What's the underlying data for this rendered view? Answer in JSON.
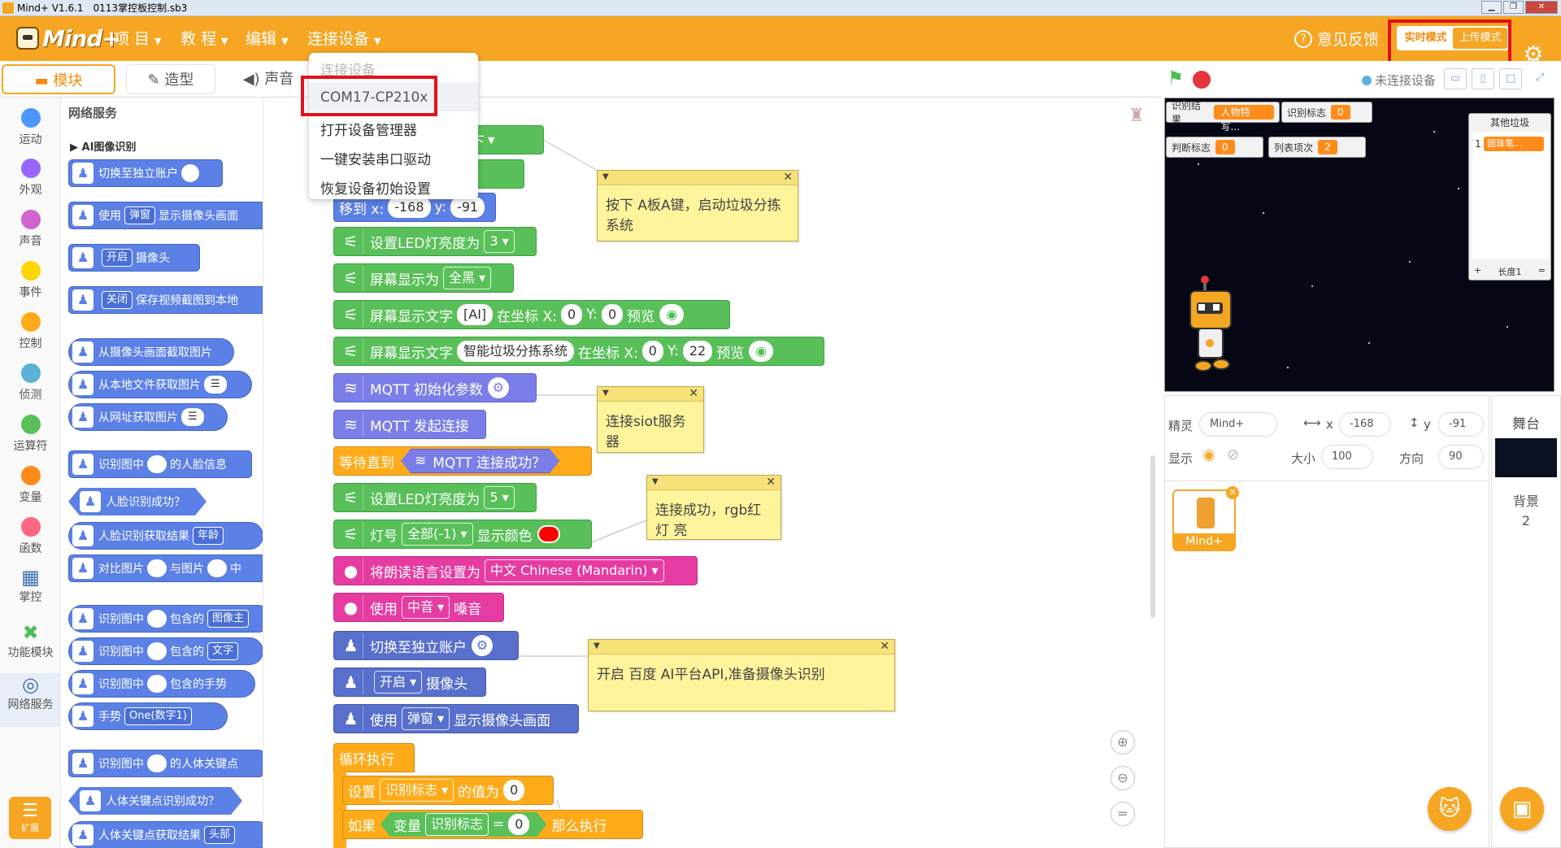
{
  "window": {
    "app_title": "Mind+ V1.6.1",
    "file_name": "0113掌控板控制.sb3"
  },
  "menubar": {
    "logo_text": "Mind+",
    "items": [
      {
        "label": "项 目"
      },
      {
        "label": "教 程"
      },
      {
        "label": "编辑"
      },
      {
        "label": "连接设备"
      }
    ],
    "feedback": "意见反馈",
    "mode_realtime": "实时模式",
    "mode_upload": "上传模式"
  },
  "tabs": {
    "code": "模块",
    "costume": "造型",
    "sound": "声音"
  },
  "device_menu": {
    "header": "连接设备",
    "port": "COM17-CP210x",
    "open_manager": "打开设备管理器",
    "install_driver": "一键安装串口驱动",
    "reset_device": "恢复设备初始设置"
  },
  "categories": [
    {
      "label": "运动",
      "color": "#4c97ff"
    },
    {
      "label": "外观",
      "color": "#9966ff"
    },
    {
      "label": "声音",
      "color": "#cf63cf"
    },
    {
      "label": "事件",
      "color": "#ffd500"
    },
    {
      "label": "控制",
      "color": "#ffab19"
    },
    {
      "label": "侦测",
      "color": "#5cb1d6"
    },
    {
      "label": "运算符",
      "color": "#59c059"
    },
    {
      "label": "变量",
      "color": "#ff8c1a"
    },
    {
      "label": "函数",
      "color": "#ff6680"
    },
    {
      "label": "掌控",
      "icon": "chip-icon"
    },
    {
      "label": "功能模块",
      "icon": "tools-icon"
    },
    {
      "label": "网络服务",
      "icon": "globe-icon"
    }
  ],
  "extension_label": "扩展",
  "palette": {
    "title": "网络服务",
    "subtitle": "AI图像识别",
    "blocks": {
      "b1": "切换至独立账户",
      "b2a": "使用",
      "b2b": "弹窗",
      "b2c": "显示摄像头画面",
      "b3a": "开启",
      "b3b": "摄像头",
      "b4a": "关闭",
      "b4b": "保存视频截图到本地",
      "b5": "从摄像头画面截取图片",
      "b6": "从本地文件获取图片",
      "b7": "从网址获取图片",
      "b8a": "识别图中",
      "b8b": "的人脸信息",
      "b9": "人脸识别成功？",
      "b10a": "人脸识别获取结果",
      "b10b": "年龄",
      "b11a": "对比图片",
      "b11b": "与图片",
      "b11c": "中",
      "b12a": "识别图中",
      "b12b": "包含的",
      "b12c": "图像主",
      "b13a": "识别图中",
      "b13b": "包含的",
      "b13c": "文字",
      "b14a": "识别图中",
      "b14b": "包含的手势",
      "b15a": "手势",
      "b15b": "One(数字1)",
      "b16a": "识别图中",
      "b16b": "的人体关键点",
      "b17": "人体关键点识别成功？",
      "b18a": "人体关键点获取结果",
      "b18b": "头部"
    }
  },
  "script": {
    "b_press": "按下",
    "b_led": "ED",
    "b_move": {
      "label": "移到 x:",
      "x": "-168",
      "ylabel": "y:",
      "y": "-91"
    },
    "b_led_brightness": {
      "label": "设置LED灯亮度为",
      "value": "3"
    },
    "b_screen_show": {
      "label": "屏幕显示为",
      "value": "全黑"
    },
    "b_screen_text1": {
      "label": "屏幕显示文字",
      "text": "[AI]",
      "coord": "在坐标 X:",
      "x": "0",
      "y_label": "Y:",
      "y": "0",
      "preview": "预览"
    },
    "b_screen_text2": {
      "label": "屏幕显示文字",
      "text": "智能垃圾分拣系统",
      "coord": "在坐标 X:",
      "x": "0",
      "y_label": "Y:",
      "y": "22",
      "preview": "预览"
    },
    "b_mqtt_init": "MQTT 初始化参数",
    "b_mqtt_connect": "MQTT 发起连接",
    "b_wait": {
      "label": "等待直到",
      "cond": "MQTT 连接成功？"
    },
    "b_led_brightness2": {
      "label": "设置LED灯亮度为",
      "value": "5"
    },
    "b_lamp": {
      "label": "灯号",
      "value": "全部(-1)",
      "color_label": "显示颜色"
    },
    "b_tts_lang": {
      "label": "将朗读语言设置为",
      "value": "中文 Chinese (Mandarin)"
    },
    "b_tts_voice": {
      "label": "使用",
      "value": "中音",
      "suffix": "嗓音"
    },
    "b_switch": "切换至独立账户",
    "b_cam_on": {
      "value": "开启",
      "suffix": "摄像头"
    },
    "b_cam_show": {
      "label": "使用",
      "value": "弹窗",
      "suffix": "显示摄像头画面"
    },
    "b_loop": "循环执行",
    "b_set": {
      "label": "设置",
      "var": "识别标志",
      "mid": "的值为",
      "value": "0"
    },
    "b_if": {
      "label": "如果",
      "var_prefix": "变量",
      "var": "识别标志",
      "op": "=",
      "value": "0",
      "then": "那么执行"
    }
  },
  "comments": {
    "c1": "按下 A板A键，启动垃圾分拣 系统",
    "c2": "连接siot服务器",
    "c3": "连接成功，rgb红灯 亮",
    "c4": "开启 百度 AI平台API,准备摄像头识别"
  },
  "stage": {
    "device_status": "未连接设备",
    "monitors": {
      "m1_label": "识别结果",
      "m1_value": "人物特写...",
      "m2_label": "识别标志",
      "m2_value": "0",
      "m3_label": "判断标志",
      "m3_value": "0",
      "m4_label": "列表项次",
      "m4_value": "2"
    },
    "list": {
      "title": "其他垃圾",
      "index": "1",
      "value": "圆珠笔...",
      "add": "+",
      "length": "长度1",
      "resize": "="
    }
  },
  "sprite_info": {
    "sprite_label": "精灵",
    "sprite_name": "Mind+",
    "x_label": "x",
    "x": "-168",
    "y_label": "y",
    "y": "-91",
    "show_label": "显示",
    "size_label": "大小",
    "size": "100",
    "direction_label": "方向",
    "direction": "90",
    "thumb_name": "Mind+"
  },
  "stage_panel": {
    "title": "舞台",
    "bg_label": "背景",
    "bg_count": "2"
  }
}
